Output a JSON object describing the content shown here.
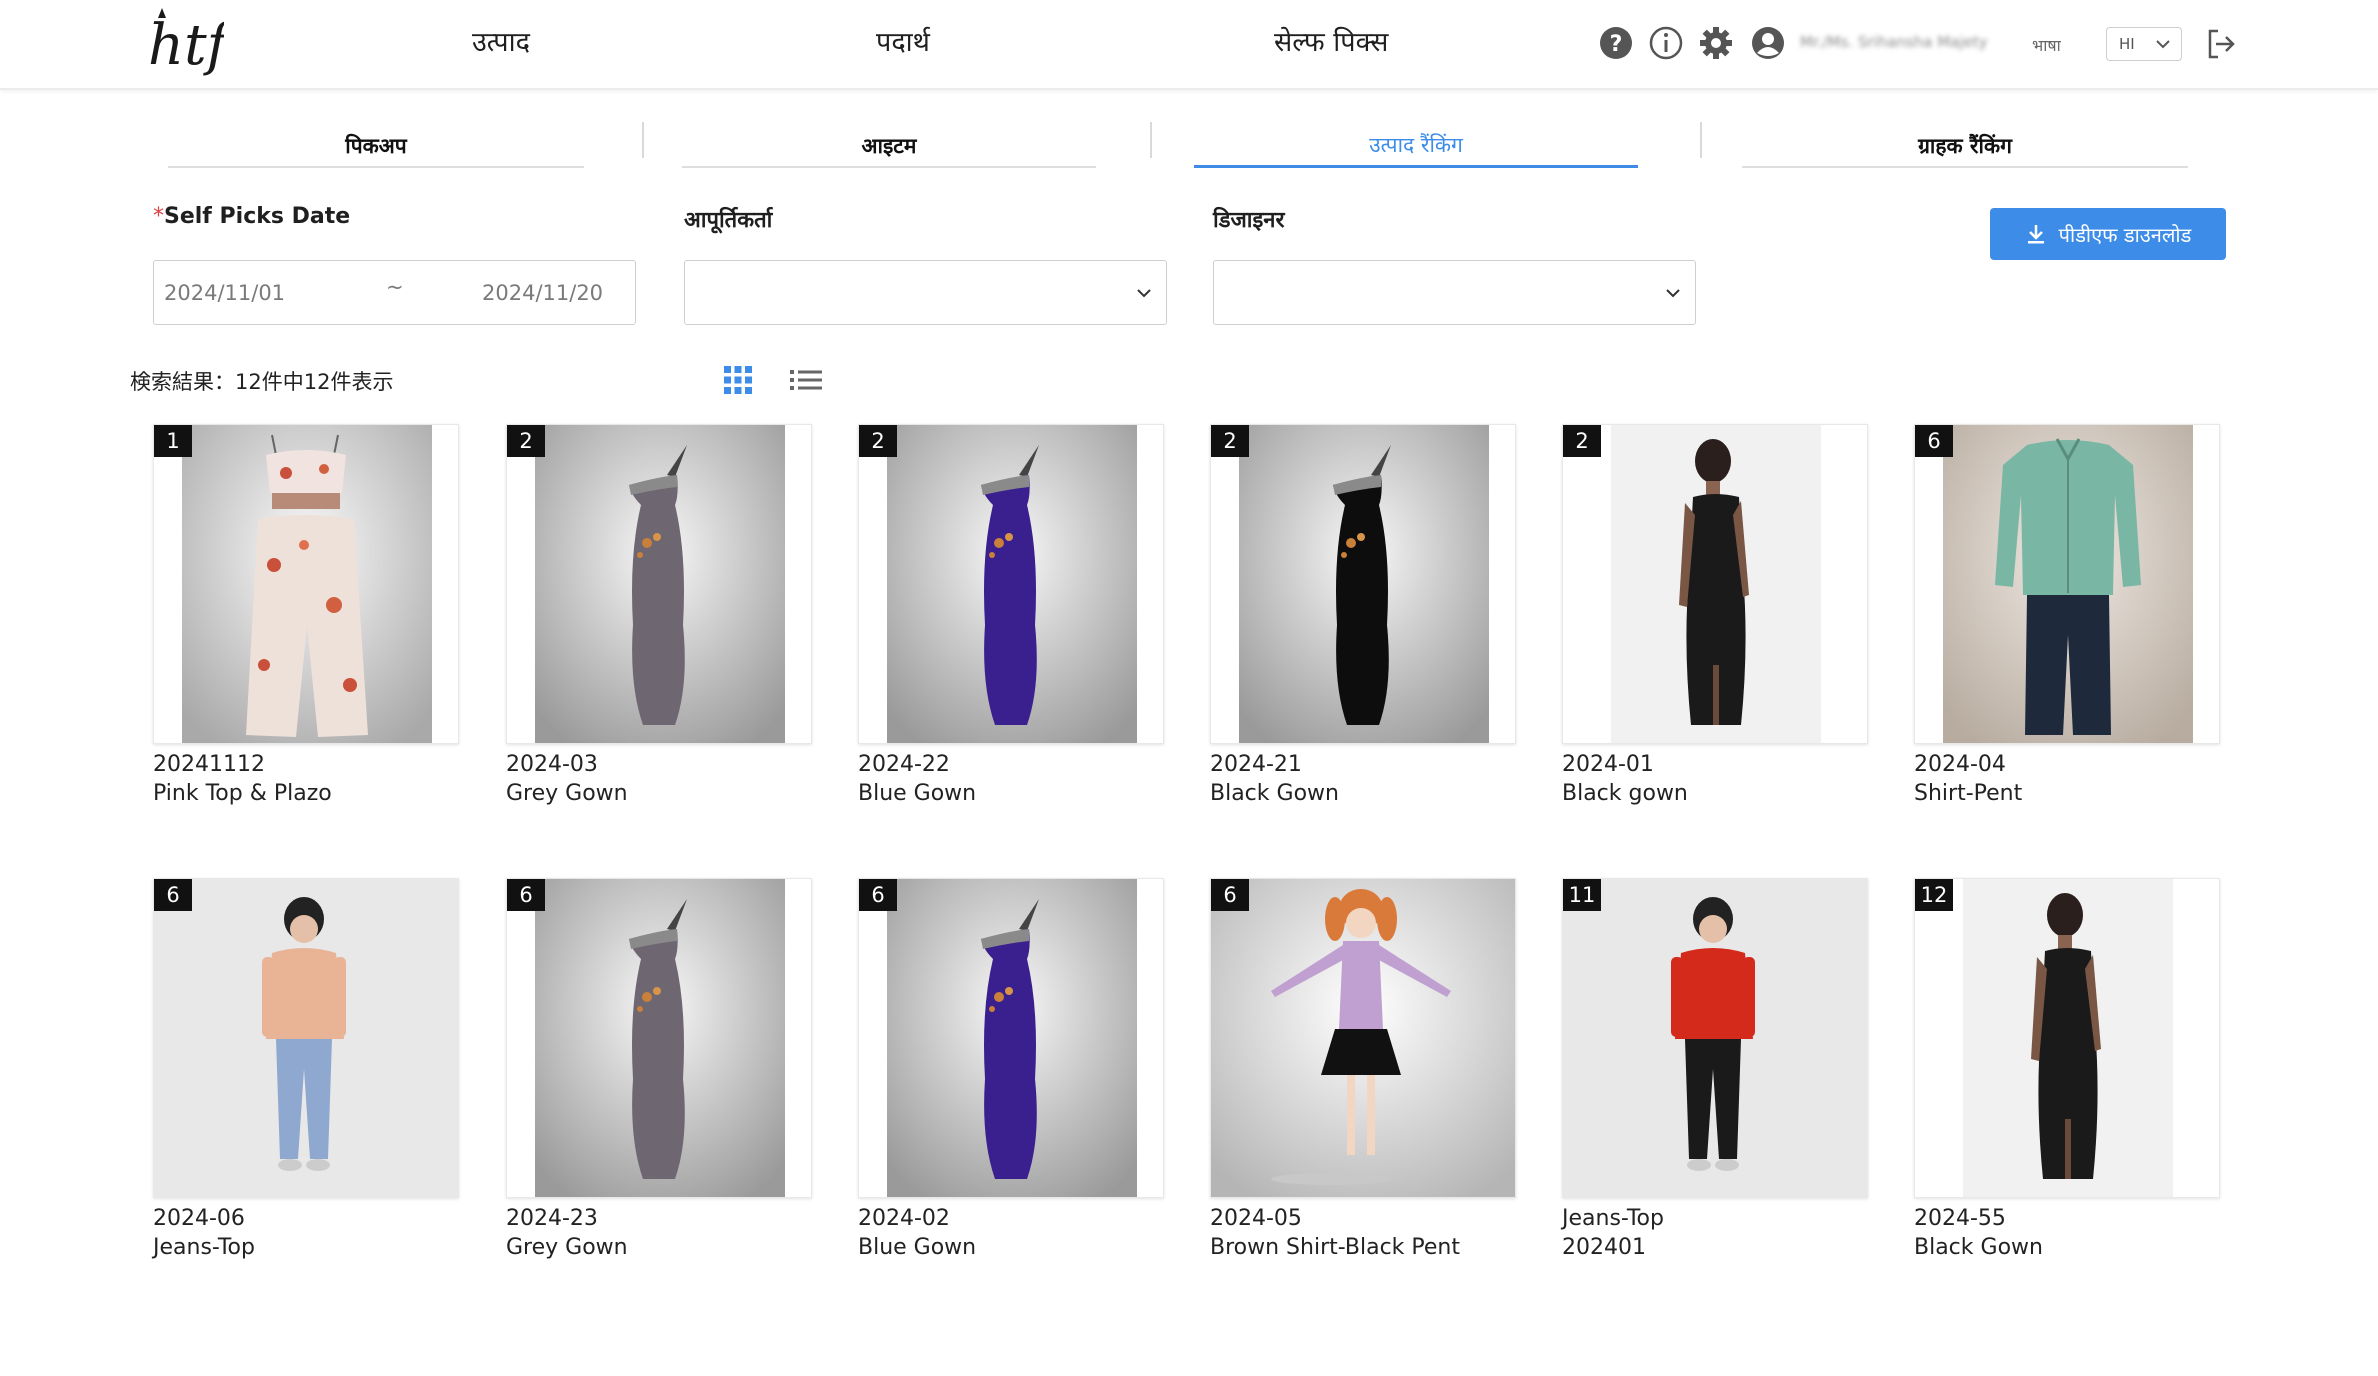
{
  "header": {
    "logo_text": "htf",
    "nav": [
      "उत्पाद",
      "पदार्थ",
      "सेल्फ पिक्स"
    ],
    "icons": [
      "help-icon",
      "info-icon",
      "gear-icon",
      "user-icon"
    ],
    "user_name": "Mr./Ms. Srihansha Majety",
    "language_label": "भाषा",
    "language_value": "HI"
  },
  "tabs": [
    {
      "label": "पिकअप",
      "active": false
    },
    {
      "label": "आइटम",
      "active": false
    },
    {
      "label": "उत्पाद रैंकिंग",
      "active": true
    },
    {
      "label": "ग्राहक रैंकिंग",
      "active": false
    }
  ],
  "filters": {
    "date_label": "Self Picks Date",
    "date_required_mark": "*",
    "date_from": "2024/11/01",
    "date_separator": "~",
    "date_to": "2024/11/20",
    "supplier_label": "आपूर्तिकर्ता",
    "supplier_value": "",
    "designer_label": "डिजाइनर",
    "designer_value": ""
  },
  "pdf_button": {
    "label": "पीडीएफ डाउनलोड"
  },
  "results": {
    "summary": "検索結果：12件中12件表示"
  },
  "products": [
    {
      "rank": "1",
      "code": "20241112",
      "name": "Pink Top & Plazo",
      "style": "pinkset"
    },
    {
      "rank": "2",
      "code": "2024-03",
      "name": "Grey Gown",
      "style": "dress",
      "color": "#6e6670"
    },
    {
      "rank": "2",
      "code": "2024-22",
      "name": "Blue Gown",
      "style": "dress",
      "color": "#3a1f8f"
    },
    {
      "rank": "2",
      "code": "2024-21",
      "name": "Black Gown",
      "style": "dress",
      "color": "#0d0d0d"
    },
    {
      "rank": "2",
      "code": "2024-01",
      "name": "Black gown",
      "style": "model"
    },
    {
      "rank": "6",
      "code": "2024-04",
      "name": "Shirt-Pent",
      "style": "shirtpant"
    },
    {
      "rank": "6",
      "code": "2024-06",
      "name": "Jeans-Top",
      "style": "avatar",
      "top": "#e9b396",
      "bottom": "#8fa8cf"
    },
    {
      "rank": "6",
      "code": "2024-23",
      "name": "Grey Gown",
      "style": "dress",
      "color": "#6e6670"
    },
    {
      "rank": "6",
      "code": "2024-02",
      "name": "Blue Gown",
      "style": "dress",
      "color": "#3a1f8f"
    },
    {
      "rank": "6",
      "code": "2024-05",
      "name": "Brown Shirt-Black Pent",
      "style": "anime"
    },
    {
      "rank": "11",
      "code": "Jeans-Top",
      "name": "202401",
      "style": "avatar",
      "top": "#d42a1c",
      "bottom": "#1a1a1a"
    },
    {
      "rank": "12",
      "code": "2024-55",
      "name": "Black Gown",
      "style": "model"
    }
  ]
}
